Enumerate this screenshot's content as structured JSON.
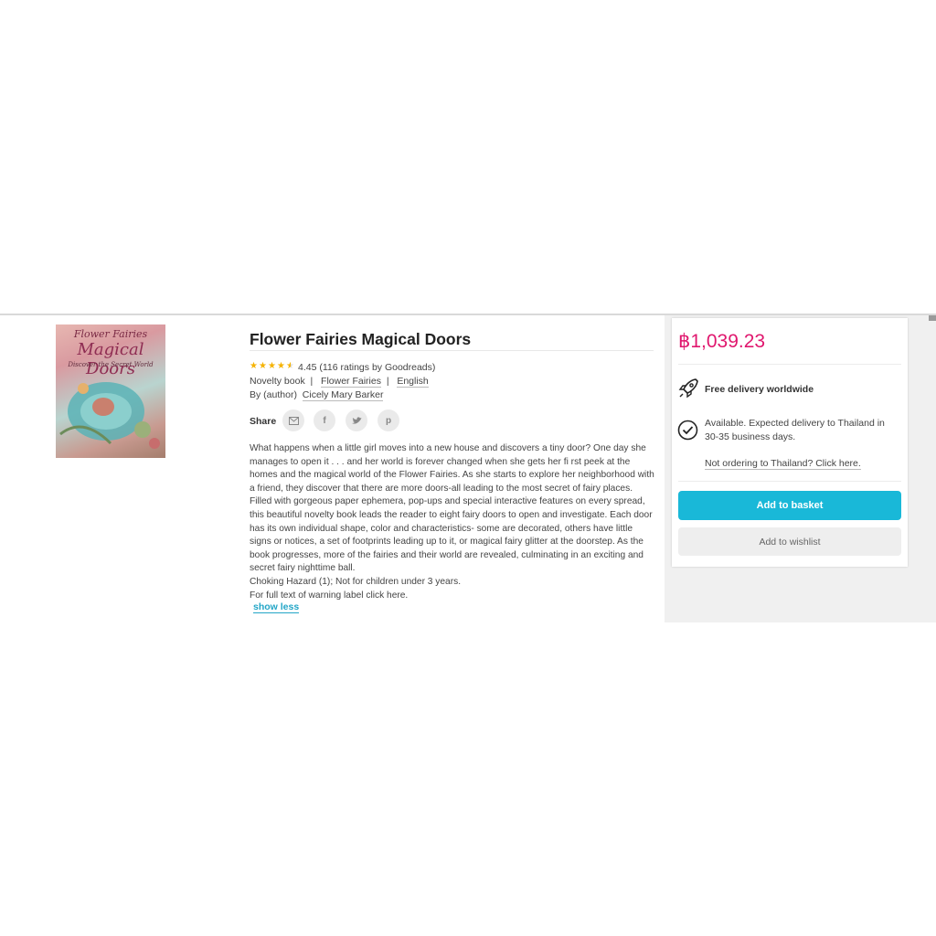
{
  "product": {
    "title": "Flower Fairies Magical Doors",
    "cover_text": {
      "series": "Flower Fairies",
      "title": "Magical Doors",
      "subtitle": "Discover the Secret World"
    },
    "rating": {
      "stars": 4.45,
      "text": "4.45 (116 ratings by Goodreads)"
    },
    "format": "Novelty book",
    "series_link": "Flower Fairies",
    "language": "English",
    "author_role": "By (author)",
    "author": "Cicely Mary Barker",
    "separator": "|"
  },
  "share": {
    "label": "Share",
    "icons": [
      "email-icon",
      "facebook-icon",
      "twitter-icon",
      "pinterest-icon"
    ]
  },
  "description": {
    "body": "What happens when a little girl moves into a new house and discovers a tiny door? One day she manages to open it . . . and her world is forever changed when she gets her fi rst peek at the homes and the magical world of the Flower Fairies. As she starts to explore her neighborhood with a friend, they discover that there are more doors-all leading to the most secret of fairy places. Filled with gorgeous paper ephemera, pop-ups and special interactive features on every spread, this beautiful novelty book leads the reader to eight fairy doors to open and investigate. Each door has its own individual shape, color and characteristics- some are decorated, others have little signs or notices, a set of footprints leading up to it, or magical fairy glitter at the doorstep. As the book progresses, more of the fairies and their world are revealed, culminating in an exciting and secret fairy nighttime ball.",
    "warning": "Choking Hazard (1); Not for children under 3 years.",
    "warning_link": "For full text of warning label click here.",
    "toggle_label": "show less"
  },
  "basket": {
    "price": "฿1,039.23",
    "free_delivery": "Free delivery worldwide",
    "availability": "Available. Expected delivery to Thailand in 30-35 business days.",
    "not_ordering": "Not ordering to Thailand? Click here.",
    "add_to_basket": "Add to basket",
    "add_to_wishlist": "Add to wishlist"
  },
  "colors": {
    "price": "#e0176e",
    "primary_button": "#19b8d8",
    "link": "#23a6c7",
    "star": "#f5b301"
  }
}
